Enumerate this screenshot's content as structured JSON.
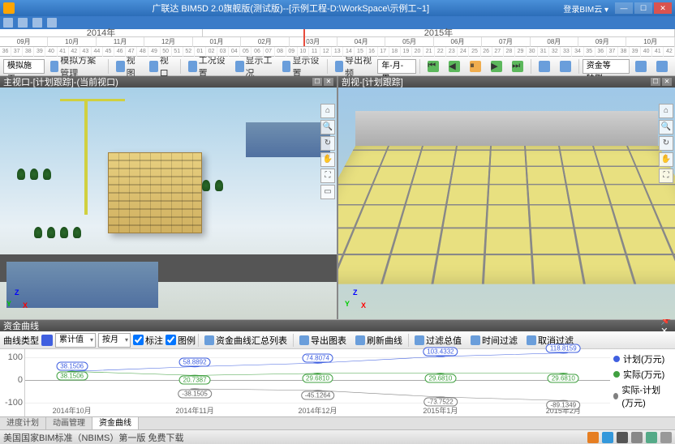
{
  "app": {
    "title": "广联达 BIM5D 2.0旗舰版(测试版)--[示例工程-D:\\WorkSpace\\示例工~1]",
    "cloud_label": "登录BIM云 ▾"
  },
  "timeline": {
    "years": [
      "2014年",
      "2015年"
    ],
    "months": [
      "09月",
      "10月",
      "11月",
      "12月",
      "01月",
      "02月",
      "03月",
      "04月",
      "05月",
      "06月",
      "07月",
      "08月",
      "09月",
      "10月"
    ],
    "weeks": [
      "36",
      "37",
      "38",
      "39",
      "40",
      "41",
      "42",
      "43",
      "44",
      "45",
      "46",
      "47",
      "48",
      "49",
      "50",
      "51",
      "52",
      "01",
      "02",
      "03",
      "04",
      "05",
      "06",
      "07",
      "08",
      "09",
      "10",
      "11",
      "12",
      "13",
      "14",
      "15",
      "16",
      "17",
      "18",
      "19",
      "20",
      "21",
      "22",
      "23",
      "24",
      "25",
      "26",
      "27",
      "28",
      "29",
      "30",
      "31",
      "32",
      "33",
      "34",
      "35",
      "36",
      "37",
      "38",
      "39",
      "40",
      "41",
      "42"
    ]
  },
  "toolbar": {
    "mode": "模拟施工",
    "scheme_mgmt": "模拟方案管理",
    "view_btn": "视图",
    "viewport_btn": "视口",
    "worker_setting": "工况设置",
    "show_worker": "显示工况",
    "show_setting": "显示设置",
    "export_video": "导出视频",
    "date_mode": "年-月-周",
    "vis_filter": "资金等轴侧"
  },
  "viewports": {
    "left_title": "主视口-[计划跟踪]-(当前视口)",
    "right_title": "剖视-[计划跟踪]"
  },
  "chart_panel": {
    "title": "资金曲线",
    "toolbar": {
      "curve_type_label": "曲线类型",
      "stat_mode": "累计值",
      "unit_mode": "按月",
      "annotate": "标注",
      "legend": "图例",
      "summary": "资金曲线汇总列表",
      "export_chart": "导出图表",
      "refresh": "刷新曲线",
      "filter_total": "过滤总值",
      "time_filter": "时间过滤",
      "cancel_filter": "取消过滤"
    },
    "legend": {
      "plan": "计划(万元)",
      "actual": "实际(万元)",
      "diff": "实际-计划(万元)"
    }
  },
  "chart_data": {
    "type": "line",
    "categories": [
      "2014年10月",
      "2014年11月",
      "2014年12月",
      "2015年1月",
      "2015年2月"
    ],
    "series": [
      {
        "name": "计划(万元)",
        "color": "#4060e0",
        "values": [
          38.1506,
          58.8892,
          74.8074,
          103.4332,
          118.8159
        ]
      },
      {
        "name": "实际(万元)",
        "color": "#40a040",
        "values": [
          38.1506,
          20.7387,
          29.681,
          29.681,
          29.681
        ]
      },
      {
        "name": "实际-计划(万元)",
        "color": "#808080",
        "values": [
          null,
          -38.1505,
          -45.1264,
          -73.7522,
          -89.1349
        ]
      }
    ],
    "ylim": [
      -100,
      100
    ],
    "yticks": [
      -100,
      0,
      100
    ]
  },
  "bottom_tabs": {
    "t1": "进度计划",
    "t2": "动画管理",
    "t3": "资金曲线"
  },
  "status": {
    "text": "美国国家BIM标准（NBIMS）第一版 免费下载"
  }
}
